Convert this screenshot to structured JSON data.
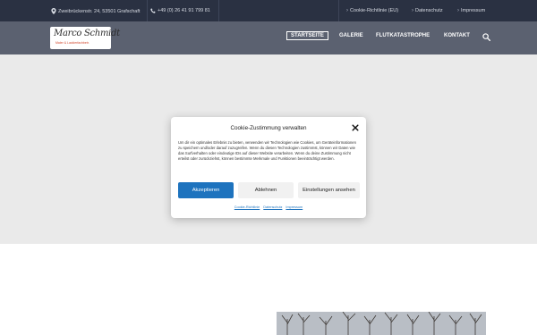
{
  "topbar": {
    "address": "Zweibrückenstr. 24, 53501 Grafschaft",
    "phone": "+49 (0) 26 41 91 799 81",
    "links": [
      "Cookie-Richtlinie (EU)",
      "Datenschutz",
      "Impressum"
    ]
  },
  "logo": {
    "script": "Marco Schmidt",
    "tagline": "Maler & Lackierfachbetr."
  },
  "nav": {
    "items": [
      "STARTSEITE",
      "GALERIE",
      "FLUTKATASTROPHE",
      "KONTAKT"
    ],
    "active_index": 0
  },
  "cookie_modal": {
    "title": "Cookie-Zustimmung verwalten",
    "body": "Um dir ein optimales Erlebnis zu bieten, verwenden wir Technologien wie Cookies, um Geräteinformationen zu speichern und/oder darauf zuzugreifen. Wenn du diesen Technologien zustimmst, können wir Daten wie das Surfverhalten oder eindeutige IDs auf dieser Website verarbeiten. Wenn du deine Zustimmung nicht erteilst oder zurückziehst, können bestimmte Merkmale und Funktionen beeinträchtigt werden.",
    "accept_label": "Akzeptieren",
    "decline_label": "Ablehnen",
    "settings_label": "Einstellungen ansehen",
    "links": [
      "Cookie-Richtlinie",
      "Datenschutz",
      "Impressum"
    ]
  },
  "colors": {
    "topbar": "#2a3142",
    "header": "#5b6170",
    "accent": "#1e73be"
  }
}
